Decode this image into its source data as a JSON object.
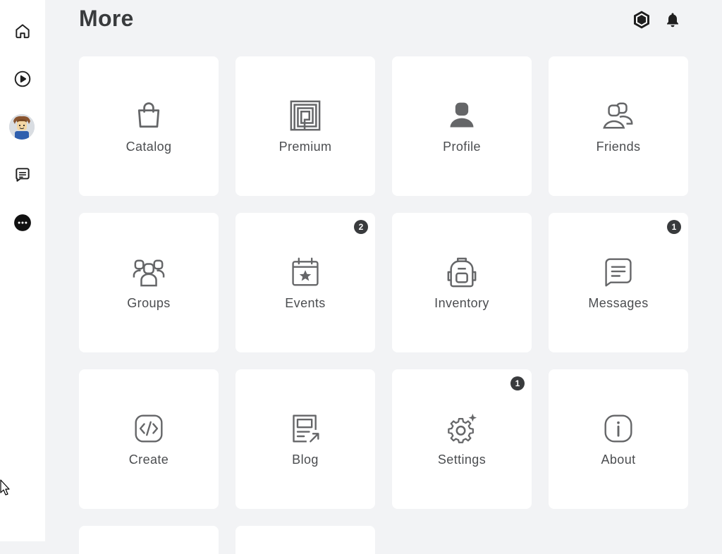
{
  "page": {
    "title": "More"
  },
  "sidebar": {
    "items": [
      {
        "name": "home",
        "icon": "home-icon"
      },
      {
        "name": "play",
        "icon": "play-icon"
      },
      {
        "name": "avatar",
        "icon": "avatar"
      },
      {
        "name": "chat",
        "icon": "chat-icon"
      },
      {
        "name": "more",
        "icon": "more-icon"
      }
    ]
  },
  "header": {
    "robux_icon": "robux-icon",
    "notifications_icon": "bell-icon"
  },
  "tiles": [
    {
      "label": "Catalog",
      "icon": "shopping-bag-icon",
      "badge": ""
    },
    {
      "label": "Premium",
      "icon": "premium-icon",
      "badge": ""
    },
    {
      "label": "Profile",
      "icon": "profile-icon",
      "badge": ""
    },
    {
      "label": "Friends",
      "icon": "friends-icon",
      "badge": ""
    },
    {
      "label": "Groups",
      "icon": "groups-icon",
      "badge": ""
    },
    {
      "label": "Events",
      "icon": "calendar-icon",
      "badge": "2"
    },
    {
      "label": "Inventory",
      "icon": "backpack-icon",
      "badge": ""
    },
    {
      "label": "Messages",
      "icon": "messages-icon",
      "badge": "1"
    },
    {
      "label": "Create",
      "icon": "code-icon",
      "badge": ""
    },
    {
      "label": "Blog",
      "icon": "blog-icon",
      "badge": ""
    },
    {
      "label": "Settings",
      "icon": "gear-icon",
      "badge": "1"
    },
    {
      "label": "About",
      "icon": "info-icon",
      "badge": ""
    }
  ],
  "colors": {
    "background": "#f2f3f5",
    "tile": "#ffffff",
    "icon": "#656668",
    "text": "#393b3d",
    "badge": "#393b3d"
  }
}
